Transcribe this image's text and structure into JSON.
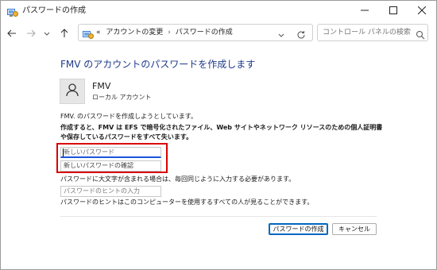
{
  "window": {
    "title": "パスワードの作成"
  },
  "nav": {
    "breadcrumb_prefix": "«",
    "breadcrumb": [
      "アカウントの変更",
      "パスワードの作成"
    ],
    "breadcrumb_separator": "›",
    "search_placeholder": "コントロール パネルの検索"
  },
  "content": {
    "heading": "FMV のアカウントのパスワードを作成します",
    "user": {
      "name": "FMV",
      "type": "ローカル アカウント"
    },
    "description": "FMV. のパスワードを作成しようとしています。",
    "warning": "作成すると、FMV は EFS で暗号化されたファイル、Web サイトやネットワーク リソースのための個人証明書や保存しているパスワードをすべて失います。",
    "new_password_placeholder": "新しいパスワード",
    "confirm_password_placeholder": "新しいパスワードの確認",
    "caps_note": "パスワードに大文字が含まれる場合は、毎回同じように入力する必要があります。",
    "hint_placeholder": "パスワードのヒントの入力",
    "hint_note": "パスワードのヒントはこのコンピューターを使用するすべての人が見ることができます。"
  },
  "buttons": {
    "create": "パスワードの作成",
    "cancel": "キャンセル"
  },
  "colors": {
    "heading": "#1e3a8a",
    "highlight": "#d90000",
    "focus": "#1a56db"
  },
  "icons": {
    "app": "control-panel-icon",
    "back": "arrow-left-icon",
    "forward": "arrow-right-icon",
    "recent": "chevron-down-icon",
    "up": "arrow-up-icon",
    "refresh": "refresh-icon",
    "search": "search-icon",
    "avatar": "user-icon"
  }
}
